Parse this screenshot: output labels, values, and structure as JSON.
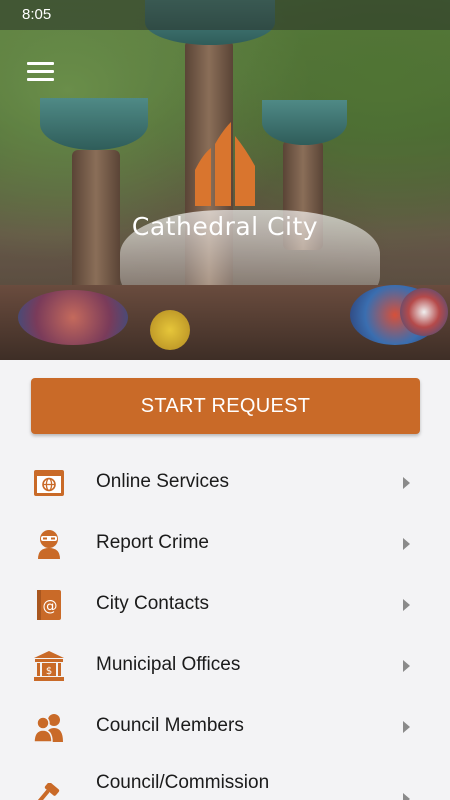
{
  "status_bar": {
    "time": "8:05"
  },
  "header": {
    "logo_text": "Cathedral City"
  },
  "actions": {
    "start_request_label": "START REQUEST"
  },
  "menu": [
    {
      "label": "Online Services",
      "icon": "globe-browser-icon"
    },
    {
      "label": "Report Crime",
      "icon": "masked-person-icon"
    },
    {
      "label": "City Contacts",
      "icon": "address-book-icon"
    },
    {
      "label": "Municipal Offices",
      "icon": "government-building-icon"
    },
    {
      "label": "Council Members",
      "icon": "people-icon"
    },
    {
      "label": "Council/Commission",
      "icon": "gavel-icon"
    }
  ],
  "colors": {
    "accent": "#c96a28",
    "icon": "#c96a28"
  }
}
